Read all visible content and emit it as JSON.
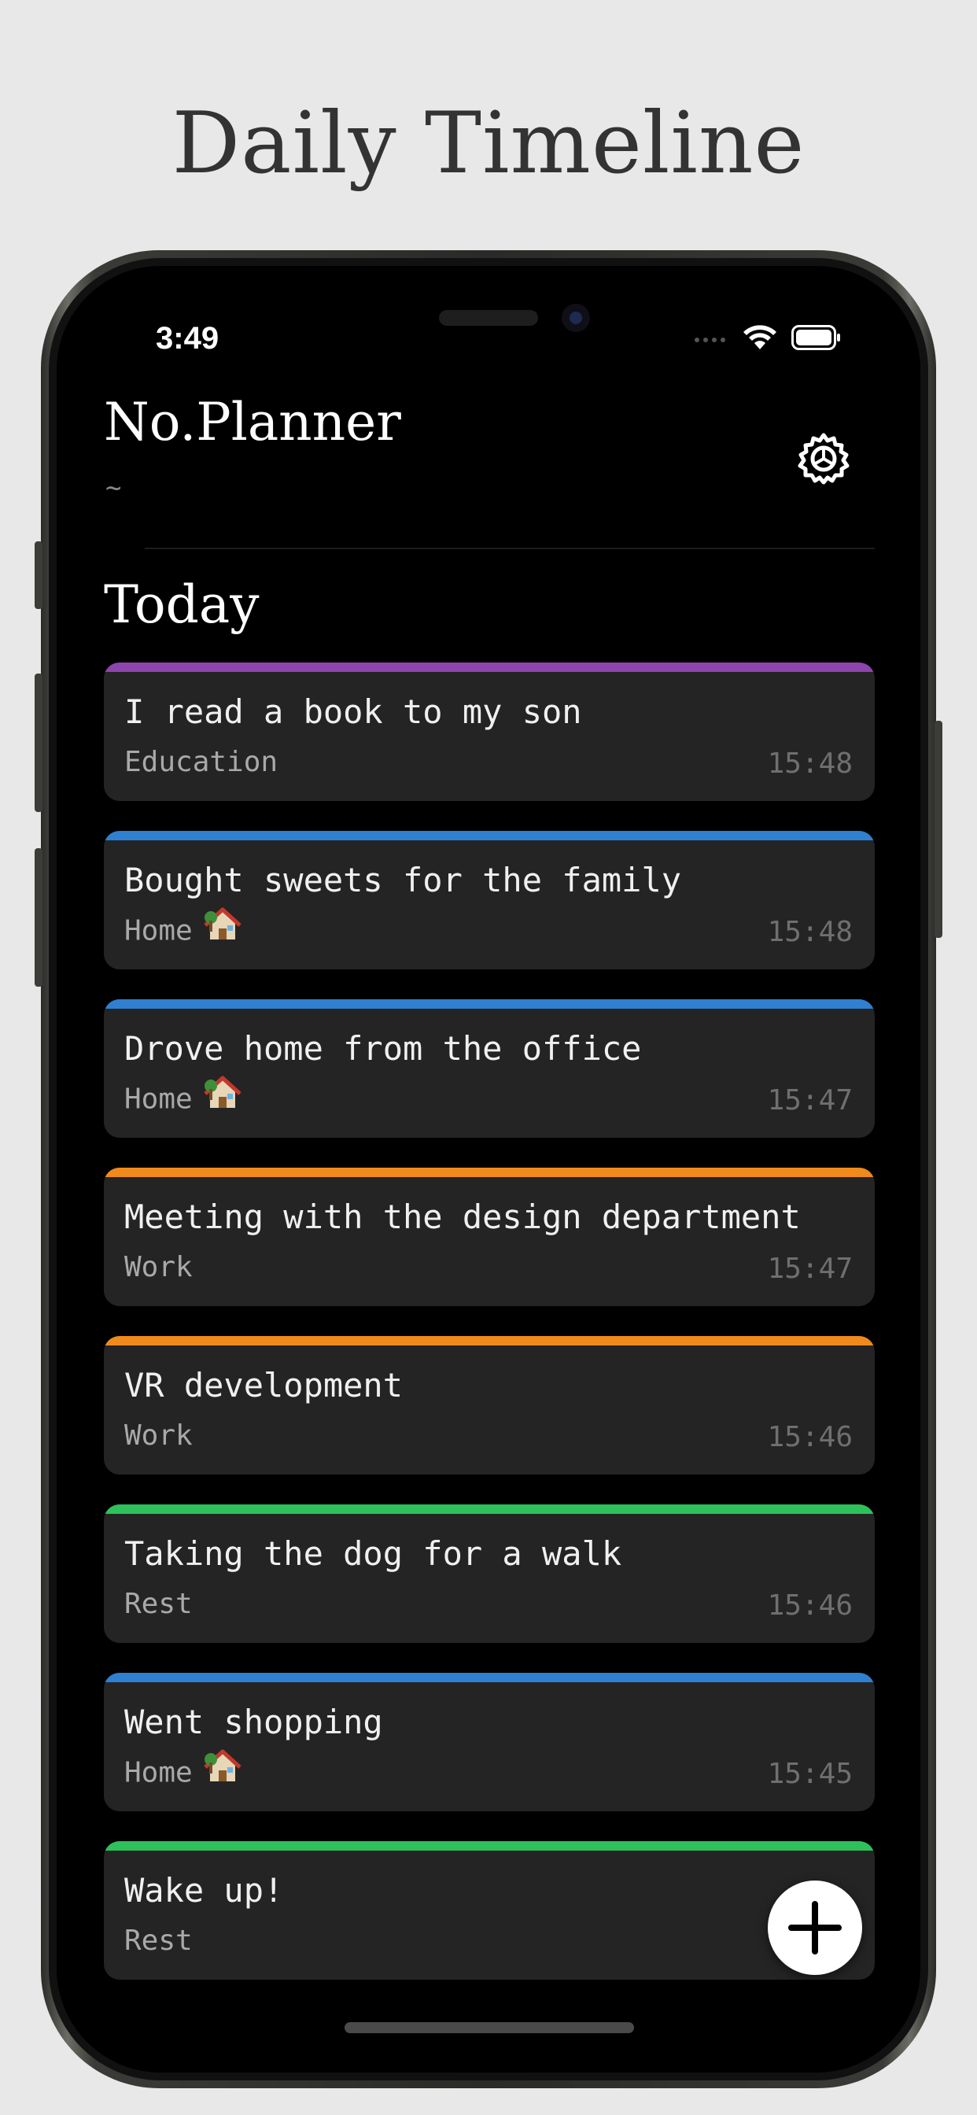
{
  "promo": {
    "title": "Daily Timeline"
  },
  "status_bar": {
    "time": "3:49",
    "icons": [
      "signal-icon",
      "wifi-icon",
      "battery-icon"
    ]
  },
  "header": {
    "title": "No.Planner",
    "subtitle": "~",
    "settings_icon": "gear-icon"
  },
  "section": {
    "title": "Today"
  },
  "colors": {
    "education": "#8e44ad",
    "home": "#2f80d0",
    "work": "#f08a1c",
    "rest": "#2ec05a"
  },
  "entries": [
    {
      "title": "I read a book to my son",
      "category": "Education",
      "time": "15:48",
      "color": "#8e44ad",
      "icon": ""
    },
    {
      "title": "Bought sweets for the family",
      "category": "Home",
      "time": "15:48",
      "color": "#2f80d0",
      "icon": "house-icon"
    },
    {
      "title": "Drove home from the office",
      "category": "Home",
      "time": "15:47",
      "color": "#2f80d0",
      "icon": "house-icon"
    },
    {
      "title": "Meeting with the design department",
      "category": "Work",
      "time": "15:47",
      "color": "#f08a1c",
      "icon": ""
    },
    {
      "title": "VR development",
      "category": "Work",
      "time": "15:46",
      "color": "#f08a1c",
      "icon": ""
    },
    {
      "title": "Taking the dog for a walk",
      "category": "Rest",
      "time": "15:46",
      "color": "#2ec05a",
      "icon": ""
    },
    {
      "title": "Went shopping",
      "category": "Home",
      "time": "15:45",
      "color": "#2f80d0",
      "icon": "house-icon"
    },
    {
      "title": "Wake up!",
      "category": "Rest",
      "time": "",
      "color": "#2ec05a",
      "icon": ""
    }
  ],
  "fab": {
    "icon": "plus-icon"
  }
}
